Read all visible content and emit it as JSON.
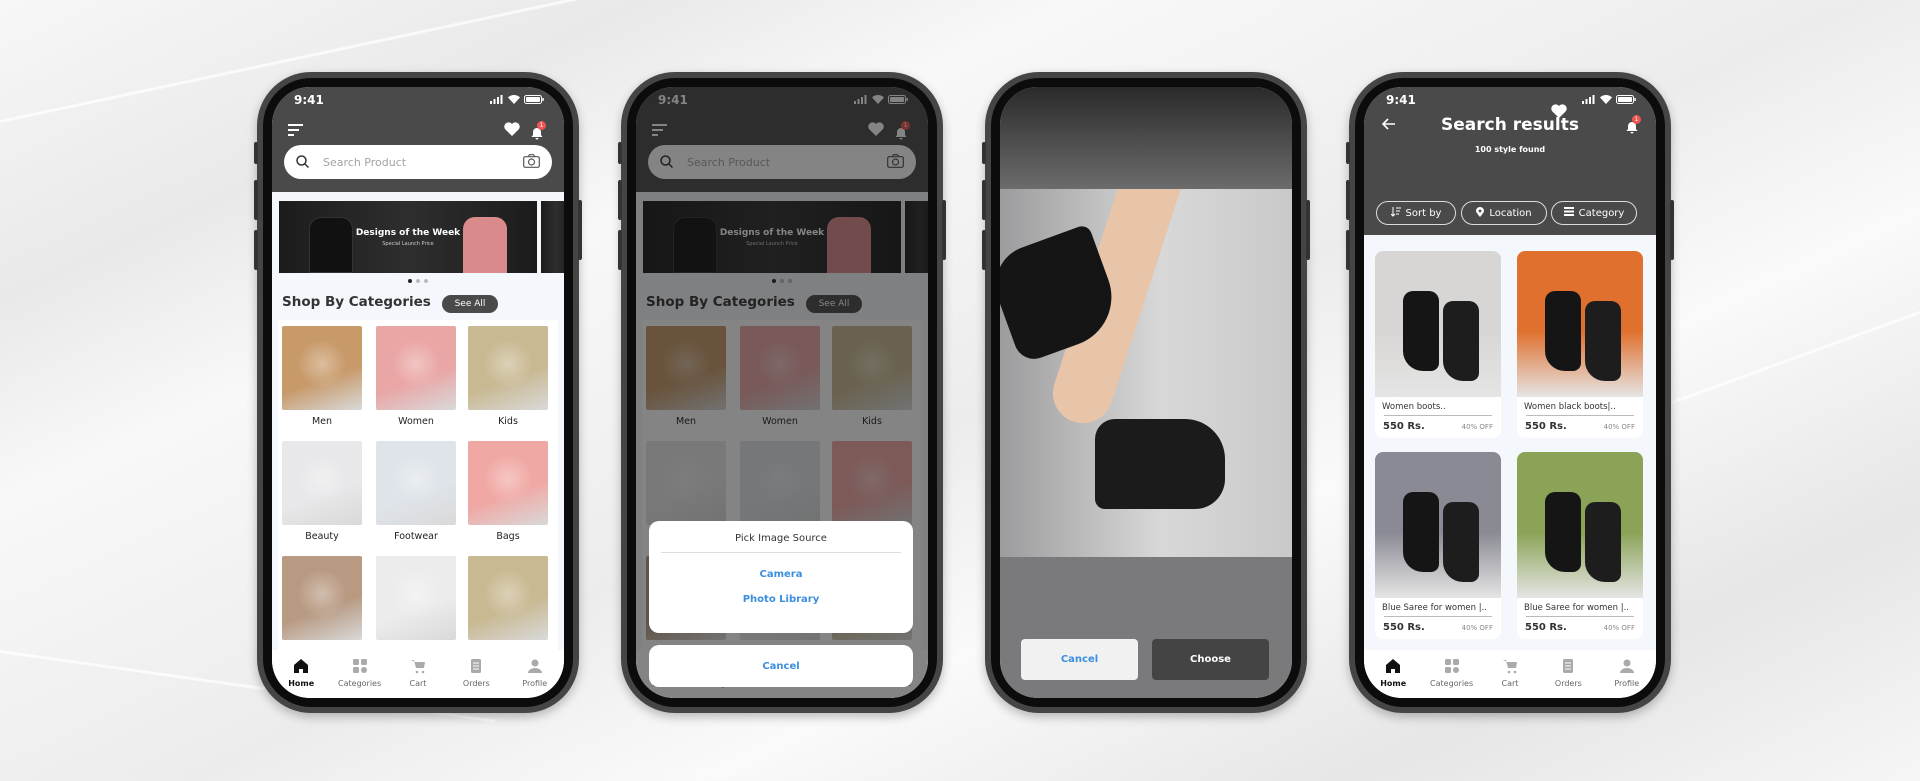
{
  "status_time": "9:41",
  "home": {
    "search_placeholder": "Search Product",
    "notification_count": "1",
    "banner": {
      "title": "Designs of the Week",
      "subtitle": "Special Launch Price"
    },
    "section_title": "Shop By Categories",
    "see_all": "See All",
    "categories": [
      {
        "label": "Men",
        "color": "#c89a6a"
      },
      {
        "label": "Women",
        "color": "#eaa5a5"
      },
      {
        "label": "Kids",
        "color": "#c9b992"
      },
      {
        "label": "Beauty",
        "color": "#e8e8ea"
      },
      {
        "label": "Footwear",
        "color": "#dfe4ea"
      },
      {
        "label": "Bags",
        "color": "#f0a8a4"
      },
      {
        "label": "",
        "color": "#b89a82"
      },
      {
        "label": "",
        "color": "#ececec"
      },
      {
        "label": "",
        "color": "#c9b992"
      }
    ]
  },
  "bottom_nav": [
    {
      "label": "Home",
      "icon": "home-icon",
      "active": true
    },
    {
      "label": "Categories",
      "icon": "grid-icon"
    },
    {
      "label": "Cart",
      "icon": "cart-icon"
    },
    {
      "label": "Orders",
      "icon": "orders-icon"
    },
    {
      "label": "Profile",
      "icon": "profile-icon"
    }
  ],
  "image_source_sheet": {
    "title": "Pick Image Source",
    "options": [
      "Camera",
      "Photo Library"
    ],
    "cancel": "Cancel"
  },
  "image_preview": {
    "cancel": "Cancel",
    "choose": "Choose"
  },
  "search_results": {
    "title": "Search results",
    "subtitle": "100 style found",
    "notification_count": "1",
    "filters": [
      {
        "label": "Sort by",
        "icon": "sort-icon"
      },
      {
        "label": "Location",
        "icon": "location-pin-icon"
      },
      {
        "label": "Category",
        "icon": "list-icon"
      }
    ],
    "products": [
      {
        "name": "Women boots..",
        "price": "550 Rs.",
        "discount": "40% OFF",
        "color": "#d8d6d4"
      },
      {
        "name": "Women black boots|..",
        "price": "550 Rs.",
        "discount": "40% OFF",
        "color": "#e0702e"
      },
      {
        "name": "Blue Saree for women |..",
        "price": "550 Rs.",
        "discount": "40% OFF",
        "color": "#8a8a94"
      },
      {
        "name": "Blue Saree for women |..",
        "price": "550 Rs.",
        "discount": "40% OFF",
        "color": "#8aa356"
      }
    ]
  },
  "colors": {
    "header": "#4a4a4a",
    "accent_blue": "#3b8ee0",
    "badge": "#f05555"
  }
}
